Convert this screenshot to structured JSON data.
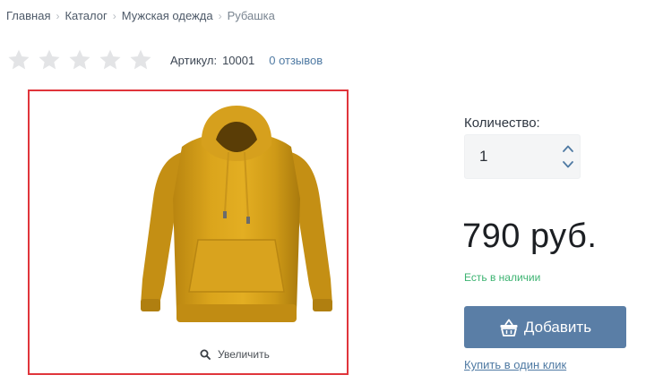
{
  "breadcrumb": {
    "items": [
      "Главная",
      "Каталог",
      "Мужская одежда",
      "Рубашка"
    ]
  },
  "rating": {
    "stars_total": 5,
    "stars_filled": 0,
    "sku_label": "Артикул:",
    "sku_value": "10001",
    "reviews_link": "0 отзывов"
  },
  "product_image": {
    "zoom_label": "Увеличить"
  },
  "quantity": {
    "label": "Количество:",
    "value": "1"
  },
  "price": "790 руб.",
  "stock_status": "Есть в наличии",
  "add_button": "Добавить",
  "one_click_link": "Купить в один клик",
  "colors": {
    "accent_button": "#5a7ea6",
    "stock_green": "#3cb371",
    "image_border": "#e0353b",
    "link": "#4f7aa3"
  }
}
